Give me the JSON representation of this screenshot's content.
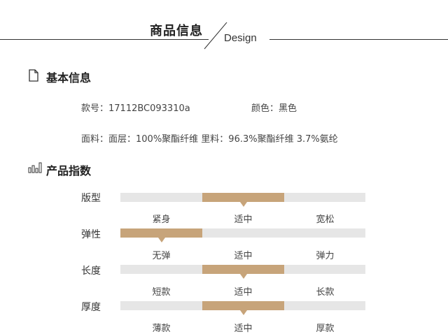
{
  "header": {
    "title": "商品信息",
    "subtitle": "Design"
  },
  "basic_info": {
    "title": "基本信息",
    "icon": "document-icon",
    "item_no": "款号：17112BC093310a",
    "color": "颜色：黑色",
    "material": "面料：面层：100%聚酯纤维 里料：96.3%聚酯纤维 3.7%氨纶"
  },
  "product_index": {
    "title": "产品指数",
    "icon": "bar-chart-icon",
    "highlight_color": "#c7a47a",
    "track_color": "#e6e6e6",
    "attributes": [
      {
        "label": "版型",
        "options": [
          "紧身",
          "适中",
          "宽松"
        ],
        "selected_index": 1
      },
      {
        "label": "弹性",
        "options": [
          "无弹",
          "适中",
          "弹力"
        ],
        "selected_index": 0
      },
      {
        "label": "长度",
        "options": [
          "短款",
          "适中",
          "长款"
        ],
        "selected_index": 1
      },
      {
        "label": "厚度",
        "options": [
          "薄款",
          "适中",
          "厚款"
        ],
        "selected_index": 1
      }
    ]
  }
}
